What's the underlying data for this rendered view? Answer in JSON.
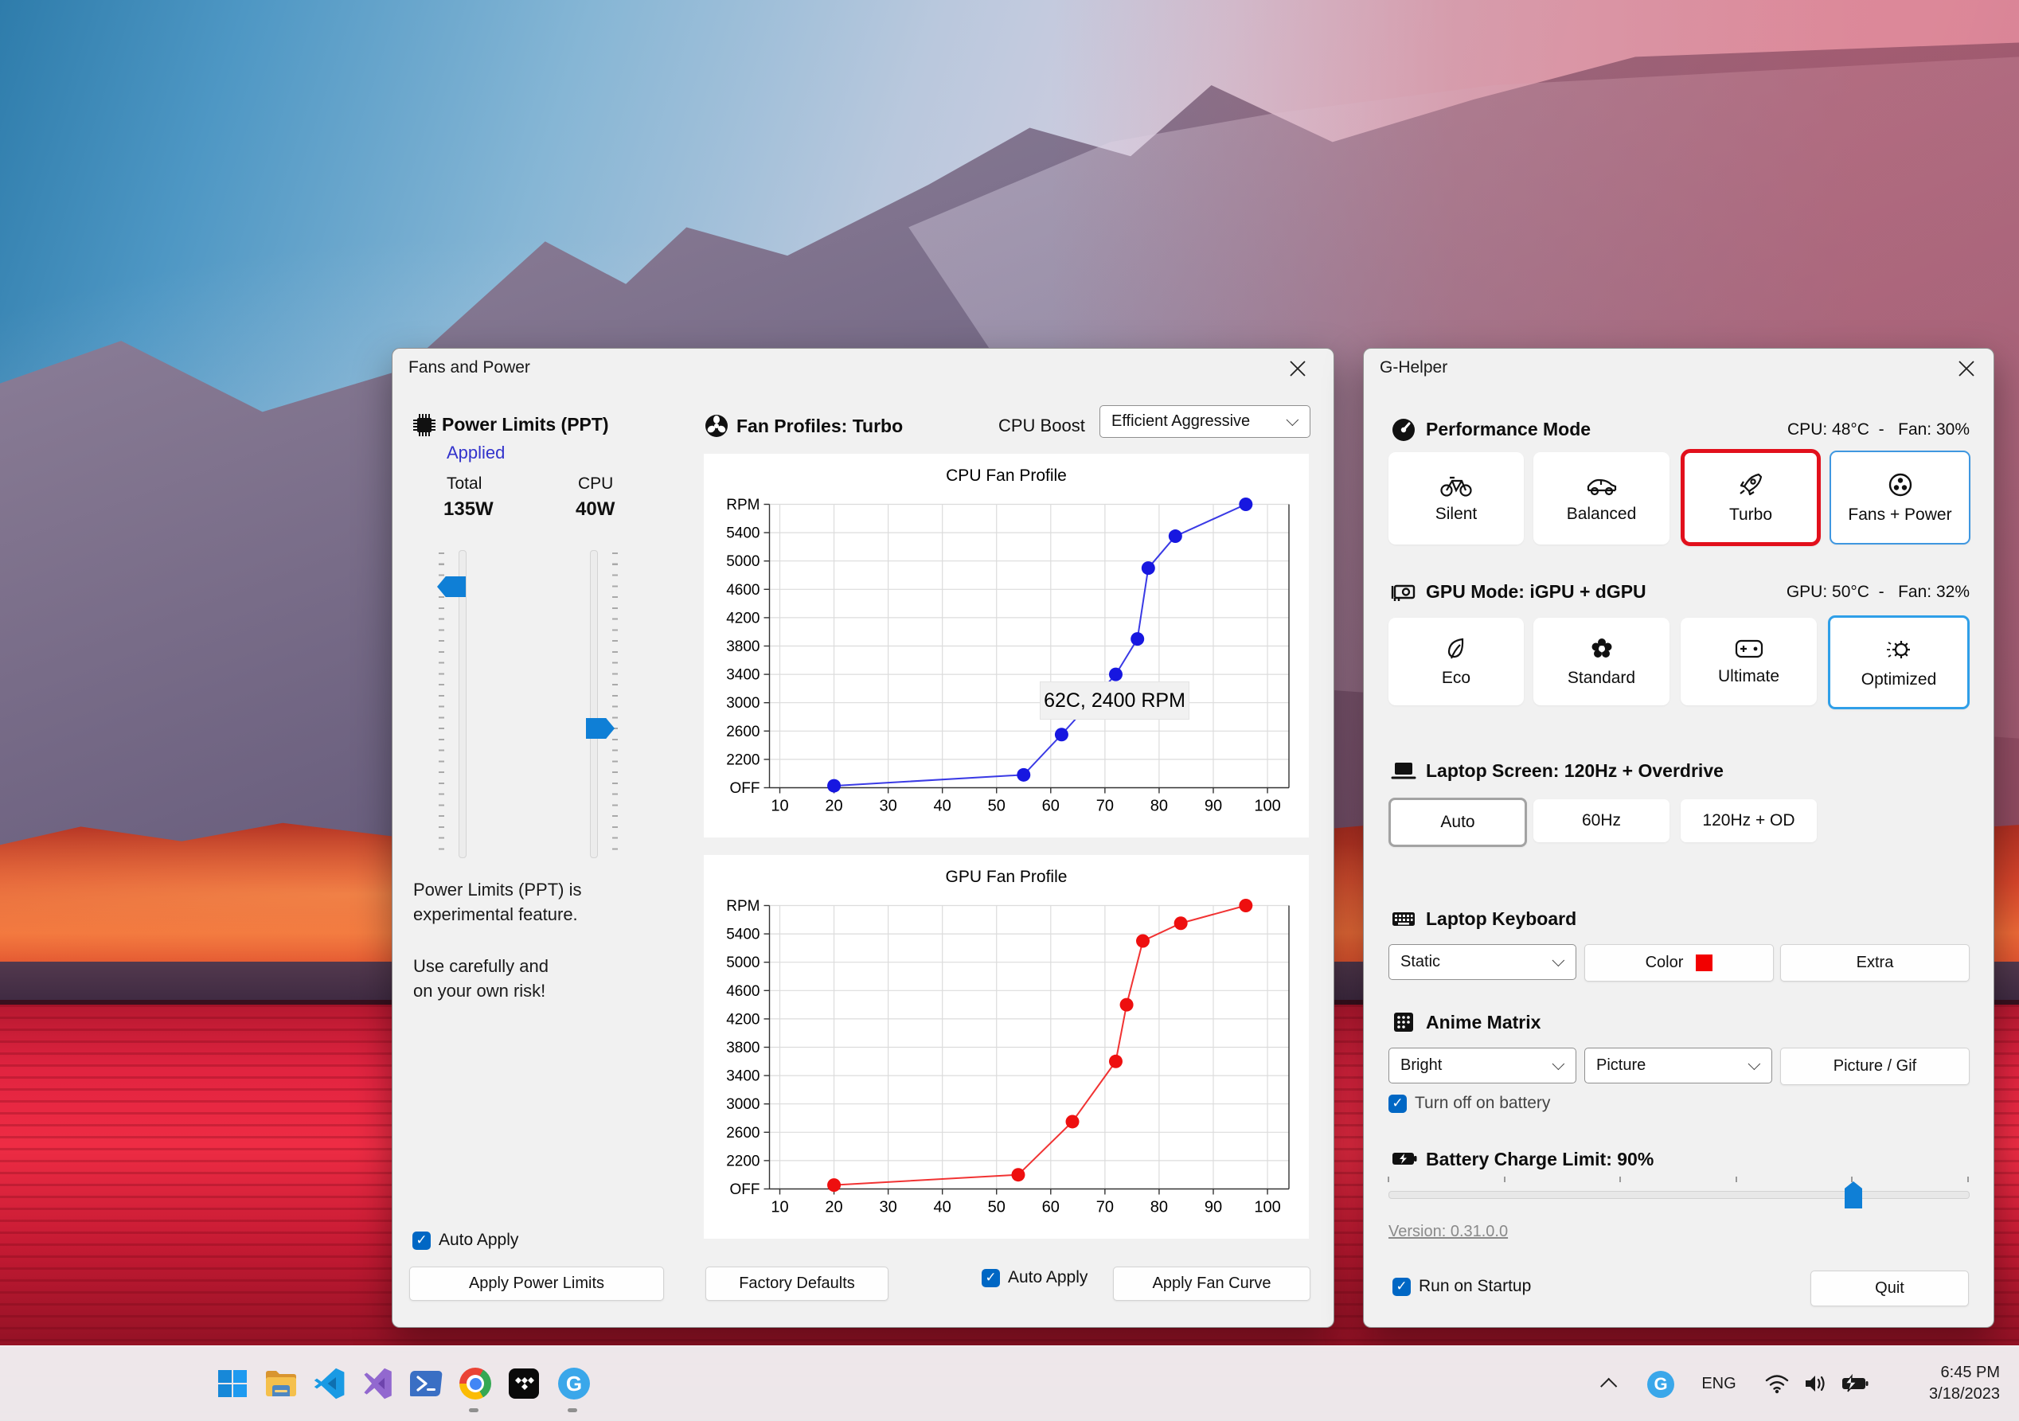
{
  "fans_window": {
    "title": "Fans and Power",
    "power_limits": {
      "heading": "Power Limits (PPT)",
      "status": "Applied",
      "total_label": "Total",
      "total_value": "135W",
      "cpu_label": "CPU",
      "cpu_value": "40W",
      "note_line1": "Power Limits (PPT) is",
      "note_line2": "experimental feature.",
      "note_line3": "Use carefully and",
      "note_line4": "on your own risk!",
      "auto_apply_label": "Auto Apply",
      "apply_button": "Apply Power Limits"
    },
    "fan_profiles": {
      "heading": "Fan Profiles: Turbo",
      "cpu_boost_label": "CPU Boost",
      "cpu_boost_value": "Efficient Aggressive",
      "factory_defaults_button": "Factory Defaults",
      "auto_apply_label": "Auto Apply",
      "apply_button": "Apply Fan Curve"
    }
  },
  "chart_data": [
    {
      "type": "line",
      "title": "CPU Fan Profile",
      "x_ticks": [
        10,
        20,
        30,
        40,
        50,
        60,
        70,
        80,
        90,
        100
      ],
      "y_tick_labels": [
        "OFF",
        "2200",
        "2600",
        "3000",
        "3400",
        "3800",
        "4200",
        "4600",
        "5000",
        "5400",
        "RPM"
      ],
      "xlim": [
        10,
        100
      ],
      "ylim": [
        "OFF",
        5800
      ],
      "grid": true,
      "legend": "none",
      "series": [
        {
          "name": "CPU fan curve",
          "color": "#1717e0",
          "points": [
            [
              20,
              150
            ],
            [
              55,
              1000
            ],
            [
              62,
              2550
            ],
            [
              72,
              3400
            ],
            [
              76,
              3900
            ],
            [
              78,
              4900
            ],
            [
              83,
              5350
            ],
            [
              96,
              5800
            ]
          ]
        }
      ],
      "tooltip": {
        "text": "62C, 2400 RPM"
      }
    },
    {
      "type": "line",
      "title": "GPU Fan Profile",
      "x_ticks": [
        10,
        20,
        30,
        40,
        50,
        60,
        70,
        80,
        90,
        100
      ],
      "y_tick_labels": [
        "OFF",
        "2200",
        "2600",
        "3000",
        "3400",
        "3800",
        "4200",
        "4600",
        "5000",
        "5400",
        "RPM"
      ],
      "xlim": [
        10,
        100
      ],
      "ylim": [
        "OFF",
        5800
      ],
      "grid": true,
      "legend": "none",
      "series": [
        {
          "name": "GPU fan curve",
          "color": "#ee0f0f",
          "points": [
            [
              20,
              300
            ],
            [
              54,
              1100
            ],
            [
              64,
              2750
            ],
            [
              72,
              3600
            ],
            [
              74,
              4400
            ],
            [
              77,
              5300
            ],
            [
              84,
              5550
            ],
            [
              96,
              5800
            ]
          ]
        }
      ]
    }
  ],
  "ghelper_window": {
    "title": "G-Helper",
    "performance": {
      "heading": "Performance Mode",
      "status": "CPU: 48°C  -   Fan: 30%",
      "buttons": [
        {
          "label": "Silent",
          "icon": "bicycle-icon"
        },
        {
          "label": "Balanced",
          "icon": "car-icon"
        },
        {
          "label": "Turbo",
          "icon": "rocket-icon",
          "selected": true
        },
        {
          "label": "Fans + Power",
          "icon": "fan-icon",
          "secondary_highlight": true
        }
      ]
    },
    "gpu": {
      "heading": "GPU Mode: iGPU + dGPU",
      "status": "GPU: 50°C  -   Fan: 32%",
      "buttons": [
        {
          "label": "Eco",
          "icon": "leaf-icon"
        },
        {
          "label": "Standard",
          "icon": "flower-icon"
        },
        {
          "label": "Ultimate",
          "icon": "gamepad-icon"
        },
        {
          "label": "Optimized",
          "icon": "auto-gear-icon",
          "selected": true
        }
      ]
    },
    "screen": {
      "heading": "Laptop Screen: 120Hz + Overdrive",
      "buttons": [
        {
          "label": "Auto",
          "selected": true
        },
        {
          "label": "60Hz"
        },
        {
          "label": "120Hz + OD"
        }
      ]
    },
    "keyboard": {
      "heading": "Laptop Keyboard",
      "mode_value": "Static",
      "color_button": "Color",
      "swatch_color": "#f20000",
      "extra_button": "Extra"
    },
    "anime_matrix": {
      "heading": "Anime Matrix",
      "brightness_value": "Bright",
      "mode_value": "Picture",
      "picture_button": "Picture / Gif",
      "battery_checkbox_label": "Turn off on battery",
      "battery_checkbox_checked": true
    },
    "battery": {
      "heading": "Battery Charge Limit: 90%",
      "percent": 90
    },
    "version_link": "Version: 0.31.0.0",
    "run_on_startup_label": "Run on Startup",
    "run_on_startup_checked": true,
    "quit_button": "Quit"
  },
  "taskbar": {
    "icons": [
      "windows-start",
      "file-explorer",
      "vscode",
      "visual-studio",
      "powershell",
      "chrome",
      "tidal",
      "g-helper"
    ],
    "running_apps": [
      "chrome",
      "g-helper"
    ],
    "tray": {
      "language": "ENG",
      "time": "6:45 PM",
      "date": "3/18/2023"
    }
  },
  "colors": {
    "accent_blue": "#0067c4",
    "slider_blue": "#0f7fd6",
    "selected_red_border": "#e2101c",
    "selected_blue_border": "#2f9fe8",
    "cpu_curve": "#1717e0",
    "gpu_curve": "#ee0f0f",
    "applied_link": "#3333cc"
  }
}
